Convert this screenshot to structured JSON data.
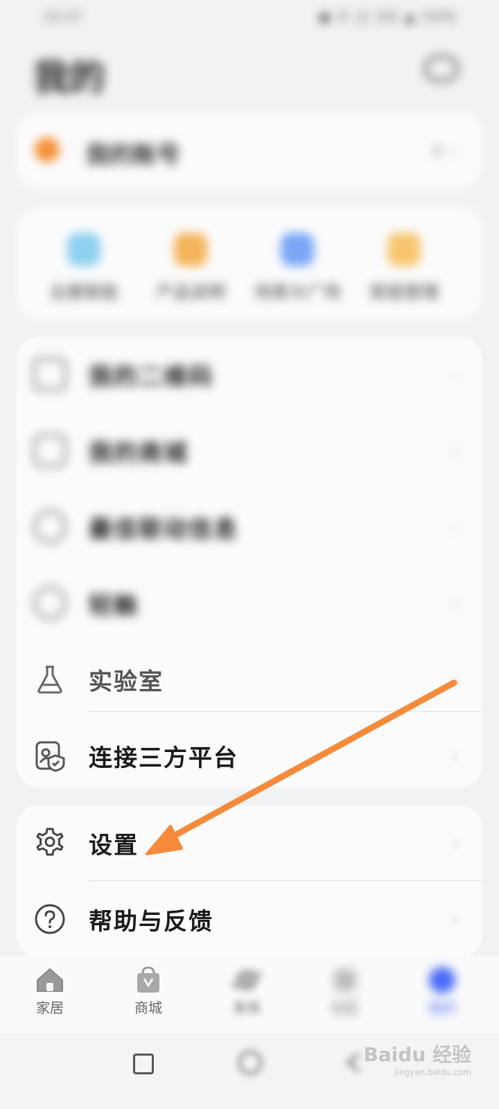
{
  "status_bar": {
    "time": "10:47",
    "icons": "◼ ✆ ◫ 5G ▲ 54%"
  },
  "header": {
    "title": "我的",
    "message_icon": "chat-bubble-icon"
  },
  "profile": {
    "label": "我的账号",
    "meta": "0 ›"
  },
  "shortcuts": [
    {
      "label": "全屋智能",
      "color": "#8fd0f0"
    },
    {
      "label": "产品说明",
      "color": "#f5b45a"
    },
    {
      "label": "场景大广场",
      "color": "#7aa7f5"
    },
    {
      "label": "家庭管理",
      "color": "#f7c66e"
    }
  ],
  "menu": [
    {
      "label": "我的二维码",
      "icon": "grid-icon"
    },
    {
      "label": "我的商城",
      "icon": "bag-icon"
    },
    {
      "label": "最佳联动信息",
      "icon": "link-icon"
    },
    {
      "label": "轻触",
      "icon": "search-icon"
    },
    {
      "label": "实验室",
      "icon": "flask-icon"
    },
    {
      "label": "连接三方平台",
      "icon": "platform-shield-icon"
    }
  ],
  "settings_menu": [
    {
      "label": "设置",
      "icon": "gear-icon"
    },
    {
      "label": "帮助与反馈",
      "icon": "help-icon"
    }
  ],
  "tabs": [
    {
      "label": "家居",
      "icon": "home-icon"
    },
    {
      "label": "商城",
      "icon": "shop-bag-icon"
    },
    {
      "label": "发现",
      "icon": "planet-icon"
    },
    {
      "label": "社区",
      "icon": "community-icon"
    },
    {
      "label": "我的",
      "icon": "profile-icon"
    }
  ],
  "chevron": "›",
  "watermark": {
    "brand": "Baidu 经验",
    "url": "jingyan.baidu.com"
  },
  "colors": {
    "accent_arrow": "#f58b3a",
    "tab_active": "#4a6cf7"
  }
}
